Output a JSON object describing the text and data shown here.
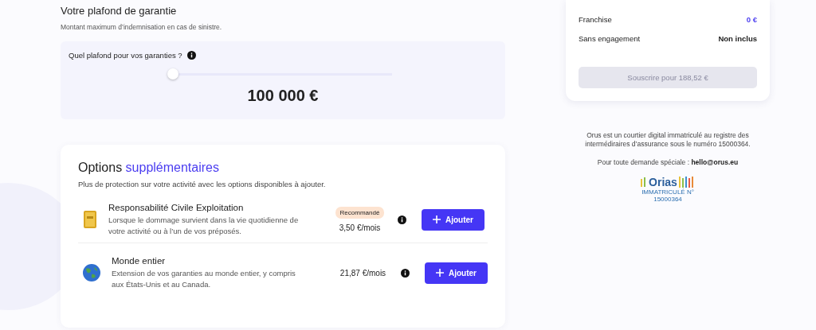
{
  "limit": {
    "title": "Votre plafond de garantie",
    "subtitle": "Montant maximum d’indemnisation en cas de sinistre.",
    "question": "Quel plafond pour vos garanties ?",
    "level": 0,
    "amount": "100 000 €"
  },
  "options": {
    "title": "Options",
    "title_accent": "supplémentaires",
    "subtitle": "Plus de protection sur votre activité avec les options disponibles à ajouter.",
    "items": [
      {
        "name": "Responsabilité Civile Exploitation",
        "description": "Lorsque le dommage survient dans la vie quotidienne de votre activité ou à l’un de vos préposés.",
        "badge": "Recommandé",
        "price": "3,50 €/mois",
        "button": "Ajouter"
      },
      {
        "name": "Monde entier",
        "description": "Extension de vos garanties au monde entier, y compris aux États-Unis et au Canada.",
        "price": "21,87 €/mois",
        "button": "Ajouter"
      }
    ]
  },
  "summary": {
    "rows": [
      {
        "label": "Franchise",
        "value": "0 €",
        "accent": true
      },
      {
        "label": "Sans engagement",
        "value": "Non inclus",
        "accent": false
      }
    ],
    "button": {
      "label": "Souscrire pour 188,52 €",
      "disabled": true
    }
  },
  "footer": {
    "text": "Orus est un courtier digital immatriculé au registre des intermédiraires d’assurance sous le numéro 15000364.",
    "contact_label": "Pour toute demande spéciale :",
    "contact_email": "hello@orus.eu",
    "badge_name": "Orias",
    "badge_caption": "IMMATRICULÉ N°",
    "badge_number": "15000364"
  }
}
